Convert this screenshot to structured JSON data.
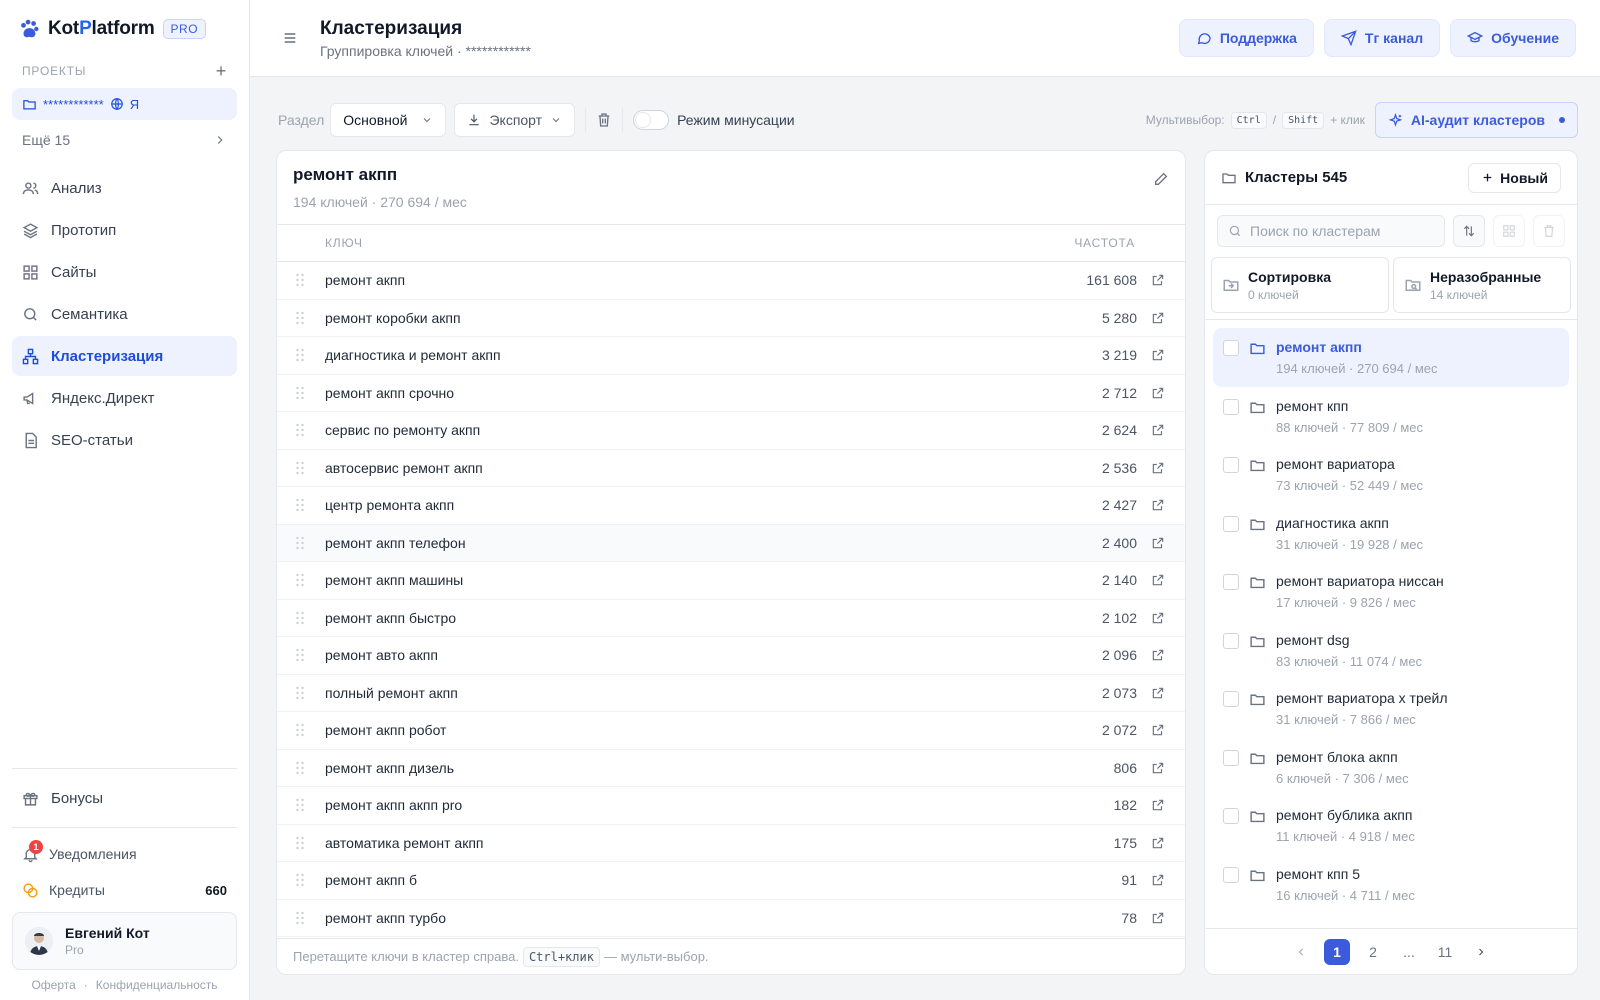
{
  "brand": {
    "name_a": "Kot",
    "name_b": "P",
    "name_c": "latform",
    "badge": "PRO"
  },
  "sidebar": {
    "projects_label": "ПРОЕКТЫ",
    "project": {
      "name": "************",
      "engine": "Я"
    },
    "more_label": "Ещё 15",
    "nav": [
      {
        "label": "Анализ",
        "icon": "users-icon",
        "active": false
      },
      {
        "label": "Прототип",
        "icon": "layers-icon",
        "active": false
      },
      {
        "label": "Сайты",
        "icon": "grid-icon",
        "active": false
      },
      {
        "label": "Семантика",
        "icon": "search-icon",
        "active": false
      },
      {
        "label": "Кластеризация",
        "icon": "network-icon",
        "active": true
      },
      {
        "label": "Яндекс.Директ",
        "icon": "megaphone-icon",
        "active": false
      },
      {
        "label": "SEO-статьи",
        "icon": "document-icon",
        "active": false
      }
    ],
    "bonus_label": "Бонусы",
    "notifications_label": "Уведомления",
    "notifications_count": "1",
    "credits_label": "Кредиты",
    "credits_value": "660",
    "user": {
      "name": "Евгений Кот",
      "role": "Pro"
    },
    "legal": {
      "offer": "Оферта",
      "sep": "·",
      "privacy": "Конфиденциальность"
    }
  },
  "header": {
    "title": "Кластеризация",
    "subtitle": "Группировка ключей · ************",
    "buttons": {
      "support": "Поддержка",
      "tg": "Тг канал",
      "learn": "Обучение"
    }
  },
  "toolbar": {
    "section_label": "Раздел",
    "section_value": "Основной",
    "export_label": "Экспорт",
    "minus_mode_label": "Режим минусации",
    "multiselect_label": "Мультивыбор:",
    "key_ctrl": "Ctrl",
    "key_sep": "/",
    "key_shift": "Shift",
    "plus_click": "+ клик",
    "ai_audit_label": "AI-аудит кластеров"
  },
  "cluster": {
    "title": "ремонт акпп",
    "meta": "194 ключей · 270 694 / мес",
    "col_key": "КЛЮЧ",
    "col_freq": "ЧАСТОТА",
    "rows": [
      {
        "key": "ремонт акпп",
        "freq": "161 608"
      },
      {
        "key": "ремонт коробки акпп",
        "freq": "5 280"
      },
      {
        "key": "диагностика и ремонт акпп",
        "freq": "3 219"
      },
      {
        "key": "ремонт акпп срочно",
        "freq": "2 712"
      },
      {
        "key": "сервис по ремонту акпп",
        "freq": "2 624"
      },
      {
        "key": "автосервис ремонт акпп",
        "freq": "2 536"
      },
      {
        "key": "центр ремонта акпп",
        "freq": "2 427"
      },
      {
        "key": "ремонт акпп телефон",
        "freq": "2 400"
      },
      {
        "key": "ремонт акпп машины",
        "freq": "2 140"
      },
      {
        "key": "ремонт акпп быстро",
        "freq": "2 102"
      },
      {
        "key": "ремонт авто акпп",
        "freq": "2 096"
      },
      {
        "key": "полный ремонт акпп",
        "freq": "2 073"
      },
      {
        "key": "ремонт акпп робот",
        "freq": "2 072"
      },
      {
        "key": "ремонт акпп дизель",
        "freq": "806"
      },
      {
        "key": "ремонт акпп акпп pro",
        "freq": "182"
      },
      {
        "key": "автоматика ремонт акпп",
        "freq": "175"
      },
      {
        "key": "ремонт акпп б",
        "freq": "91"
      },
      {
        "key": "ремонт акпп турбо",
        "freq": "78"
      }
    ],
    "footer_text": "Перетащите ключи в кластер справа.",
    "footer_key": "Ctrl+клик",
    "footer_tail": "— мульти-выбор."
  },
  "clusters_panel": {
    "title": "Кластеры 545",
    "new_label": "Новый",
    "search_placeholder": "Поиск по кластерам",
    "special": [
      {
        "name": "Сортировка",
        "count": "0 ключей"
      },
      {
        "name": "Неразобранные",
        "count": "14 ключей"
      }
    ],
    "items": [
      {
        "name": "ремонт акпп",
        "meta": "194 ключей · 270 694 / мес",
        "active": true
      },
      {
        "name": "ремонт кпп",
        "meta": "88 ключей · 77 809 / мес",
        "active": false
      },
      {
        "name": "ремонт вариатора",
        "meta": "73 ключей · 52 449 / мес",
        "active": false
      },
      {
        "name": "диагностика акпп",
        "meta": "31 ключей · 19 928 / мес",
        "active": false
      },
      {
        "name": "ремонт вариатора ниссан",
        "meta": "17 ключей · 9 826 / мес",
        "active": false
      },
      {
        "name": "ремонт dsg",
        "meta": "83 ключей · 11 074 / мес",
        "active": false
      },
      {
        "name": "ремонт вариатора х трейл",
        "meta": "31 ключей · 7 866 / мес",
        "active": false
      },
      {
        "name": "ремонт блока акпп",
        "meta": "6 ключей · 7 306 / мес",
        "active": false
      },
      {
        "name": "ремонт бублика акпп",
        "meta": "11 ключей · 4 918 / мес",
        "active": false
      },
      {
        "name": "ремонт кпп 5",
        "meta": "16 ключей · 4 711 / мес",
        "active": false
      }
    ],
    "pager": {
      "p1": "1",
      "p2": "2",
      "ellipsis": "...",
      "last": "11"
    }
  },
  "colors": {
    "accent": "#3b5bdb",
    "accent_bg": "#eef2ff",
    "badge_red": "#ef4444",
    "coin": "#f59e0b"
  }
}
